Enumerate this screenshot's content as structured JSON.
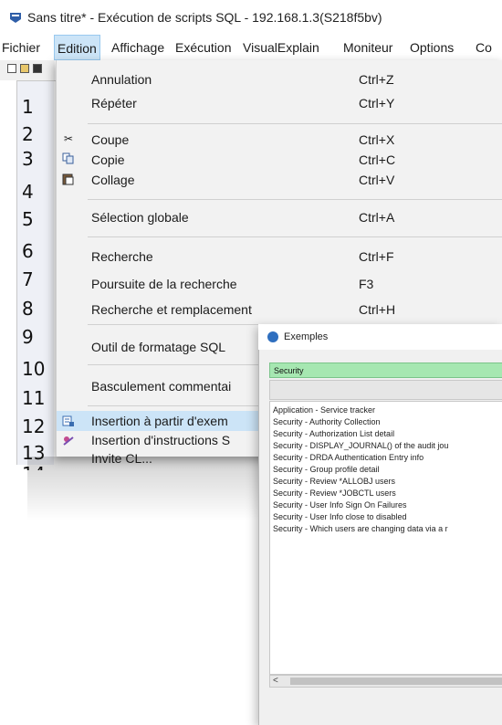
{
  "window": {
    "title": "Sans titre* - Exécution de scripts SQL - 192.168.1.3(S218f5bv)"
  },
  "menubar": {
    "items": [
      "Fichier",
      "Edition",
      "Affichage",
      "Exécution",
      "VisualExplain",
      "Moniteur",
      "Options",
      "Co"
    ]
  },
  "editor": {
    "line_numbers": [
      "1",
      "2",
      "3",
      "4",
      "5",
      "6",
      "7",
      "8",
      "9",
      "10",
      "11",
      "12",
      "13",
      "14"
    ]
  },
  "edition_menu": {
    "items": [
      {
        "label": "Annulation",
        "shortcut": "Ctrl+Z",
        "icon": ""
      },
      {
        "label": "Répéter",
        "shortcut": "Ctrl+Y",
        "icon": ""
      },
      {
        "label": "Coupe",
        "shortcut": "Ctrl+X",
        "icon": "scissors-icon"
      },
      {
        "label": "Copie",
        "shortcut": "Ctrl+C",
        "icon": "copy-icon"
      },
      {
        "label": "Collage",
        "shortcut": "Ctrl+V",
        "icon": "paste-icon"
      },
      {
        "label": "Sélection globale",
        "shortcut": "Ctrl+A",
        "icon": ""
      },
      {
        "label": "Recherche",
        "shortcut": "Ctrl+F",
        "icon": ""
      },
      {
        "label": "Poursuite de la recherche",
        "shortcut": "F3",
        "icon": ""
      },
      {
        "label": "Recherche et remplacement",
        "shortcut": "Ctrl+H",
        "icon": ""
      },
      {
        "label": "Outil de formatage SQL",
        "shortcut": "",
        "icon": ""
      },
      {
        "label": "Basculement commentai",
        "shortcut": "",
        "icon": ""
      },
      {
        "label": "Insertion à partir d'exem",
        "shortcut": "",
        "icon": "insert-examples-icon"
      },
      {
        "label": "Insertion d'instructions S",
        "shortcut": "",
        "icon": "insert-statements-icon"
      },
      {
        "label": "Invite CL...",
        "shortcut": "",
        "icon": ""
      }
    ],
    "highlighted": "Insertion à partir d'exem"
  },
  "examples_dialog": {
    "title": "Exemples",
    "search_value": "Security",
    "items": [
      "Application - Service tracker",
      "Security - Authority Collection",
      "Security - Authorization List detail",
      "Security - DISPLAY_JOURNAL() of the audit jou",
      "Security - DRDA Authentication Entry info",
      "Security - Group profile detail",
      "Security - Review *ALLOBJ users",
      "Security - Review *JOBCTL users",
      "Security - User Info Sign On Failures",
      "Security - User Info close to disabled",
      "Security - Which users are changing data via a r"
    ],
    "scroll_left": "<"
  },
  "colors": {
    "highlight": "#cce4f7",
    "search_bg": "#a6e7b1",
    "menu_bg": "#f2f2f2"
  }
}
